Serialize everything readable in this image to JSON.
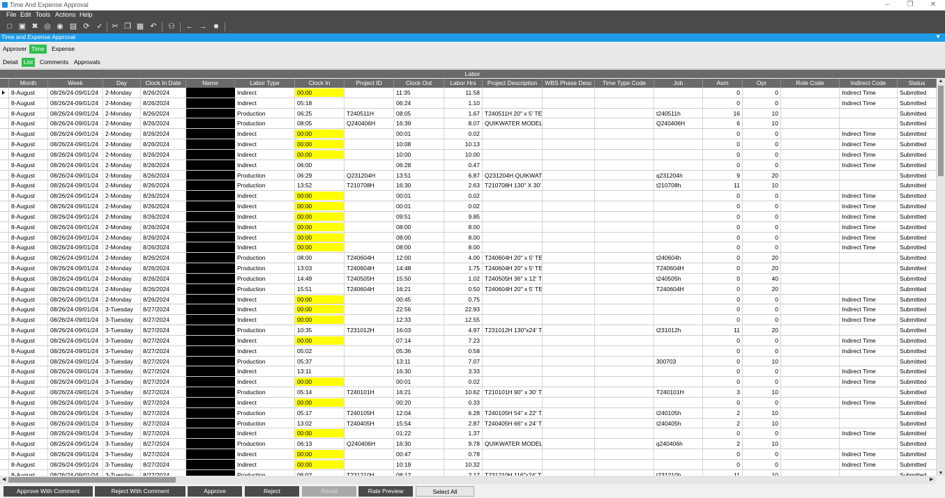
{
  "window": {
    "title": "Time And Expense Approval"
  },
  "menu": [
    "File",
    "Edit",
    "Tools",
    "Actions",
    "Help"
  ],
  "toolbar_icons": [
    "new-icon",
    "save-icon",
    "delete-icon",
    "binoculars-icon",
    "globe-icon",
    "print-icon",
    "refresh-icon",
    "check-icon",
    "cut-icon",
    "copy-icon",
    "paste-icon",
    "undo-icon",
    "search-icon",
    "back-icon",
    "forward-icon",
    "stop-icon"
  ],
  "panel_title": "Time and Expense Approval",
  "tabs_primary": [
    {
      "label": "Approver",
      "active": false
    },
    {
      "label": "Time",
      "active": true
    },
    {
      "label": "Expense",
      "active": false
    }
  ],
  "tabs_secondary": [
    {
      "label": "Detail",
      "active": false
    },
    {
      "label": "List",
      "active": true
    },
    {
      "label": "Comments",
      "active": false
    },
    {
      "label": "Approvals",
      "active": false
    }
  ],
  "grid_title": "Labor",
  "highlight_color": "#ffff00",
  "columns": [
    "Month",
    "Week",
    "Day",
    "Clock In Date",
    "Name",
    "Labor Type",
    "Clock In",
    "Project ID",
    "Clock Out",
    "Labor Hrs",
    "Project Description",
    "WBS Phase Desc",
    "Time Type Code",
    "Job",
    "Asm",
    "Opr",
    "Role Code",
    "Indirect Code",
    "Status"
  ],
  "rows": [
    [
      "8-August",
      "08/26/24-09/01/24",
      "2-Monday",
      "8/26/2024",
      "",
      "Indirect",
      "00:00",
      "",
      "11:35",
      "11.58",
      "",
      "",
      "",
      "",
      "0",
      "0",
      "",
      "Indirect Time",
      "Submitted",
      1
    ],
    [
      "8-August",
      "08/26/24-09/01/24",
      "2-Monday",
      "8/26/2024",
      "",
      "Indirect",
      "05:18",
      "",
      "06:24",
      "1.10",
      "",
      "",
      "",
      "",
      "0",
      "0",
      "",
      "Indirect Time",
      "Submitted",
      0
    ],
    [
      "8-August",
      "08/26/24-09/01/24",
      "2-Monday",
      "8/26/2024",
      "",
      "Production",
      "06:25",
      "T240511H",
      "08:05",
      "1.67",
      "T240511H 20\" x 5' TE",
      "",
      "",
      "t240511h",
      "16",
      "10",
      "",
      "",
      "Submitted",
      0
    ],
    [
      "8-August",
      "08/26/24-09/01/24",
      "2-Monday",
      "8/26/2024",
      "",
      "Production",
      "08:05",
      "Q240406H",
      "16:39",
      "8.07",
      "QUIKWATER MODEL",
      "",
      "",
      "Q240406H",
      "6",
      "10",
      "",
      "",
      "Submitted",
      0
    ],
    [
      "8-August",
      "08/26/24-09/01/24",
      "2-Monday",
      "8/26/2024",
      "",
      "Indirect",
      "00:00",
      "",
      "00:01",
      "0.02",
      "",
      "",
      "",
      "",
      "0",
      "0",
      "",
      "Indirect Time",
      "Submitted",
      1
    ],
    [
      "8-August",
      "08/26/24-09/01/24",
      "2-Monday",
      "8/26/2024",
      "",
      "Indirect",
      "00:00",
      "",
      "10:08",
      "10.13",
      "",
      "",
      "",
      "",
      "0",
      "0",
      "",
      "Indirect Time",
      "Submitted",
      1
    ],
    [
      "8-August",
      "08/26/24-09/01/24",
      "2-Monday",
      "8/26/2024",
      "",
      "Indirect",
      "00:00",
      "",
      "10:00",
      "10.00",
      "",
      "",
      "",
      "",
      "0",
      "0",
      "",
      "Indirect Time",
      "Submitted",
      1
    ],
    [
      "8-August",
      "08/26/24-09/01/24",
      "2-Monday",
      "8/26/2024",
      "",
      "Indirect",
      "06:00",
      "",
      "06:28",
      "0.47",
      "",
      "",
      "",
      "",
      "0",
      "0",
      "",
      "Indirect Time",
      "Submitted",
      0
    ],
    [
      "8-August",
      "08/26/24-09/01/24",
      "2-Monday",
      "8/26/2024",
      "",
      "Production",
      "06:29",
      "Q231204H",
      "13:51",
      "6.87",
      "Q231204H QUIKWAT",
      "",
      "",
      "q231204h",
      "9",
      "20",
      "",
      "",
      "Submitted",
      0
    ],
    [
      "8-August",
      "08/26/24-09/01/24",
      "2-Monday",
      "8/26/2024",
      "",
      "Production",
      "13:52",
      "T210708H",
      "16:30",
      "2.63",
      "T210708H 130\" X 30'",
      "",
      "",
      "t210708h",
      "11",
      "10",
      "",
      "",
      "Submitted",
      0
    ],
    [
      "8-August",
      "08/26/24-09/01/24",
      "2-Monday",
      "8/26/2024",
      "",
      "Indirect",
      "00:00",
      "",
      "00:01",
      "0.02",
      "",
      "",
      "",
      "",
      "0",
      "0",
      "",
      "Indirect Time",
      "Submitted",
      1
    ],
    [
      "8-August",
      "08/26/24-09/01/24",
      "2-Monday",
      "8/26/2024",
      "",
      "Indirect",
      "00:00",
      "",
      "00:01",
      "0.02",
      "",
      "",
      "",
      "",
      "0",
      "0",
      "",
      "Indirect Time",
      "Submitted",
      1
    ],
    [
      "8-August",
      "08/26/24-09/01/24",
      "2-Monday",
      "8/26/2024",
      "",
      "Indirect",
      "00:00",
      "",
      "09:51",
      "9.85",
      "",
      "",
      "",
      "",
      "0",
      "0",
      "",
      "Indirect Time",
      "Submitted",
      1
    ],
    [
      "8-August",
      "08/26/24-09/01/24",
      "2-Monday",
      "8/26/2024",
      "",
      "Indirect",
      "00:00",
      "",
      "08:00",
      "8.00",
      "",
      "",
      "",
      "",
      "0",
      "0",
      "",
      "Indirect Time",
      "Submitted",
      1
    ],
    [
      "8-August",
      "08/26/24-09/01/24",
      "2-Monday",
      "8/26/2024",
      "",
      "Indirect",
      "00:00",
      "",
      "08:00",
      "8.00",
      "",
      "",
      "",
      "",
      "0",
      "0",
      "",
      "Indirect Time",
      "Submitted",
      1
    ],
    [
      "8-August",
      "08/26/24-09/01/24",
      "2-Monday",
      "8/26/2024",
      "",
      "Indirect",
      "00:00",
      "",
      "08:00",
      "8.00",
      "",
      "",
      "",
      "",
      "0",
      "0",
      "",
      "Indirect Time",
      "Submitted",
      1
    ],
    [
      "8-August",
      "08/26/24-09/01/24",
      "2-Monday",
      "8/26/2024",
      "",
      "Production",
      "08:00",
      "T240604H",
      "12:00",
      "4.00",
      "T240604H 20\" x 5' TE",
      "",
      "",
      "t240604h",
      "0",
      "20",
      "",
      "",
      "Submitted",
      0
    ],
    [
      "8-August",
      "08/26/24-09/01/24",
      "2-Monday",
      "8/26/2024",
      "",
      "Production",
      "13:03",
      "T240604H",
      "14:48",
      "1.75",
      "T240604H 20\" x 5' TE",
      "",
      "",
      "T240604H",
      "0",
      "20",
      "",
      "",
      "Submitted",
      0
    ],
    [
      "8-August",
      "08/26/24-09/01/24",
      "2-Monday",
      "8/26/2024",
      "",
      "Production",
      "14:49",
      "T240505H",
      "15:50",
      "1.02",
      "T240505H 36\" x 12' T",
      "",
      "",
      "t240505h",
      "0",
      "40",
      "",
      "",
      "Submitted",
      0
    ],
    [
      "8-August",
      "08/26/24-09/01/24",
      "2-Monday",
      "8/26/2024",
      "",
      "Production",
      "15:51",
      "T240604H",
      "16:21",
      "0.50",
      "T240604H 20\" x 5' TE",
      "",
      "",
      "T240604H",
      "0",
      "20",
      "",
      "",
      "Submitted",
      0
    ],
    [
      "8-August",
      "08/26/24-09/01/24",
      "2-Monday",
      "8/26/2024",
      "",
      "Indirect",
      "00:00",
      "",
      "00:45",
      "0.75",
      "",
      "",
      "",
      "",
      "0",
      "0",
      "",
      "Indirect Time",
      "Submitted",
      1
    ],
    [
      "8-August",
      "08/26/24-09/01/24",
      "3-Tuesday",
      "8/27/2024",
      "",
      "Indirect",
      "00:00",
      "",
      "22:56",
      "22.93",
      "",
      "",
      "",
      "",
      "0",
      "0",
      "",
      "Indirect Time",
      "Submitted",
      1
    ],
    [
      "8-August",
      "08/26/24-09/01/24",
      "3-Tuesday",
      "8/27/2024",
      "",
      "Indirect",
      "00:00",
      "",
      "12:33",
      "12.55",
      "",
      "",
      "",
      "",
      "0",
      "0",
      "",
      "Indirect Time",
      "Submitted",
      1
    ],
    [
      "8-August",
      "08/26/24-09/01/24",
      "3-Tuesday",
      "8/27/2024",
      "",
      "Production",
      "10:35",
      "T231012H",
      "16:03",
      "4.97",
      "T231012H 130\"x24' T",
      "",
      "",
      "t231012h",
      "11",
      "20",
      "",
      "",
      "Submitted",
      0
    ],
    [
      "8-August",
      "08/26/24-09/01/24",
      "3-Tuesday",
      "8/27/2024",
      "",
      "Indirect",
      "00:00",
      "",
      "07:14",
      "7.23",
      "",
      "",
      "",
      "",
      "0",
      "0",
      "",
      "Indirect Time",
      "Submitted",
      1
    ],
    [
      "8-August",
      "08/26/24-09/01/24",
      "3-Tuesday",
      "8/27/2024",
      "",
      "Indirect",
      "05:02",
      "",
      "05:36",
      "0.58",
      "",
      "",
      "",
      "",
      "0",
      "0",
      "",
      "Indirect Time",
      "Submitted",
      0
    ],
    [
      "8-August",
      "08/26/24-09/01/24",
      "3-Tuesday",
      "8/27/2024",
      "",
      "Production",
      "05:37",
      "",
      "13:11",
      "7.07",
      "",
      "",
      "",
      "300703",
      "0",
      "10",
      "",
      "",
      "Submitted",
      0
    ],
    [
      "8-August",
      "08/26/24-09/01/24",
      "3-Tuesday",
      "8/27/2024",
      "",
      "Indirect",
      "13:11",
      "",
      "16:30",
      "3.33",
      "",
      "",
      "",
      "",
      "0",
      "0",
      "",
      "Indirect Time",
      "Submitted",
      0
    ],
    [
      "8-August",
      "08/26/24-09/01/24",
      "3-Tuesday",
      "8/27/2024",
      "",
      "Indirect",
      "00:00",
      "",
      "00:01",
      "0.02",
      "",
      "",
      "",
      "",
      "0",
      "0",
      "",
      "Indirect Time",
      "Submitted",
      1
    ],
    [
      "8-August",
      "08/26/24-09/01/24",
      "3-Tuesday",
      "8/27/2024",
      "",
      "Production",
      "05:14",
      "T240101H",
      "16:21",
      "10.62",
      "T210101H 90\" x 30' T",
      "",
      "",
      "T240101H",
      "3",
      "10",
      "",
      "",
      "Submitted",
      0
    ],
    [
      "8-August",
      "08/26/24-09/01/24",
      "3-Tuesday",
      "8/27/2024",
      "",
      "Indirect",
      "00:00",
      "",
      "00:20",
      "0.33",
      "",
      "",
      "",
      "",
      "0",
      "0",
      "",
      "Indirect Time",
      "Submitted",
      1
    ],
    [
      "8-August",
      "08/26/24-09/01/24",
      "3-Tuesday",
      "8/27/2024",
      "",
      "Production",
      "05:17",
      "T240105H",
      "12:04",
      "6.28",
      "T240105H 54\" x 22' T",
      "",
      "",
      "t240105h",
      "2",
      "10",
      "",
      "",
      "Submitted",
      0
    ],
    [
      "8-August",
      "08/26/24-09/01/24",
      "3-Tuesday",
      "8/27/2024",
      "",
      "Production",
      "13:02",
      "T240405H",
      "15:54",
      "2.87",
      "T240405H 66\" x 24' T",
      "",
      "",
      "t240405h",
      "2",
      "10",
      "",
      "",
      "Submitted",
      0
    ],
    [
      "8-August",
      "08/26/24-09/01/24",
      "3-Tuesday",
      "8/27/2024",
      "",
      "Indirect",
      "00:00",
      "",
      "01:22",
      "1.37",
      "",
      "",
      "",
      "",
      "0",
      "0",
      "",
      "Indirect Time",
      "Submitted",
      1
    ],
    [
      "8-August",
      "08/26/24-09/01/24",
      "3-Tuesday",
      "8/27/2024",
      "",
      "Production",
      "06:13",
      "Q240406H",
      "16:30",
      "9.78",
      "QUIKWATER MODEL",
      "",
      "",
      "q240406h",
      "2",
      "10",
      "",
      "",
      "Submitted",
      0
    ],
    [
      "8-August",
      "08/26/24-09/01/24",
      "3-Tuesday",
      "8/27/2024",
      "",
      "Indirect",
      "00:00",
      "",
      "00:47",
      "0.78",
      "",
      "",
      "",
      "",
      "0",
      "0",
      "",
      "Indirect Time",
      "Submitted",
      1
    ],
    [
      "8-August",
      "08/26/24-09/01/24",
      "3-Tuesday",
      "8/27/2024",
      "",
      "Indirect",
      "00:00",
      "",
      "10:19",
      "10.32",
      "",
      "",
      "",
      "",
      "0",
      "0",
      "",
      "Indirect Time",
      "Submitted",
      1
    ],
    [
      "8-August",
      "08/26/24-09/01/24",
      "3-Tuesday",
      "8/27/2024",
      "",
      "Production",
      "06:02",
      "T231210H",
      "08:12",
      "2.17",
      "T231210H 116\"x24' T",
      "",
      "",
      "t231210h",
      "11",
      "10",
      "",
      "",
      "Submitted",
      0
    ]
  ],
  "buttons": [
    {
      "label": "Approve With Comment",
      "state": "normal"
    },
    {
      "label": "Reject With Comment",
      "state": "normal"
    },
    {
      "label": "Approve",
      "state": "normal"
    },
    {
      "label": "Reject",
      "state": "normal"
    },
    {
      "label": "Recall",
      "state": "disabled"
    },
    {
      "label": "Rate Preview",
      "state": "normal"
    },
    {
      "label": "Select All",
      "state": "light"
    }
  ]
}
